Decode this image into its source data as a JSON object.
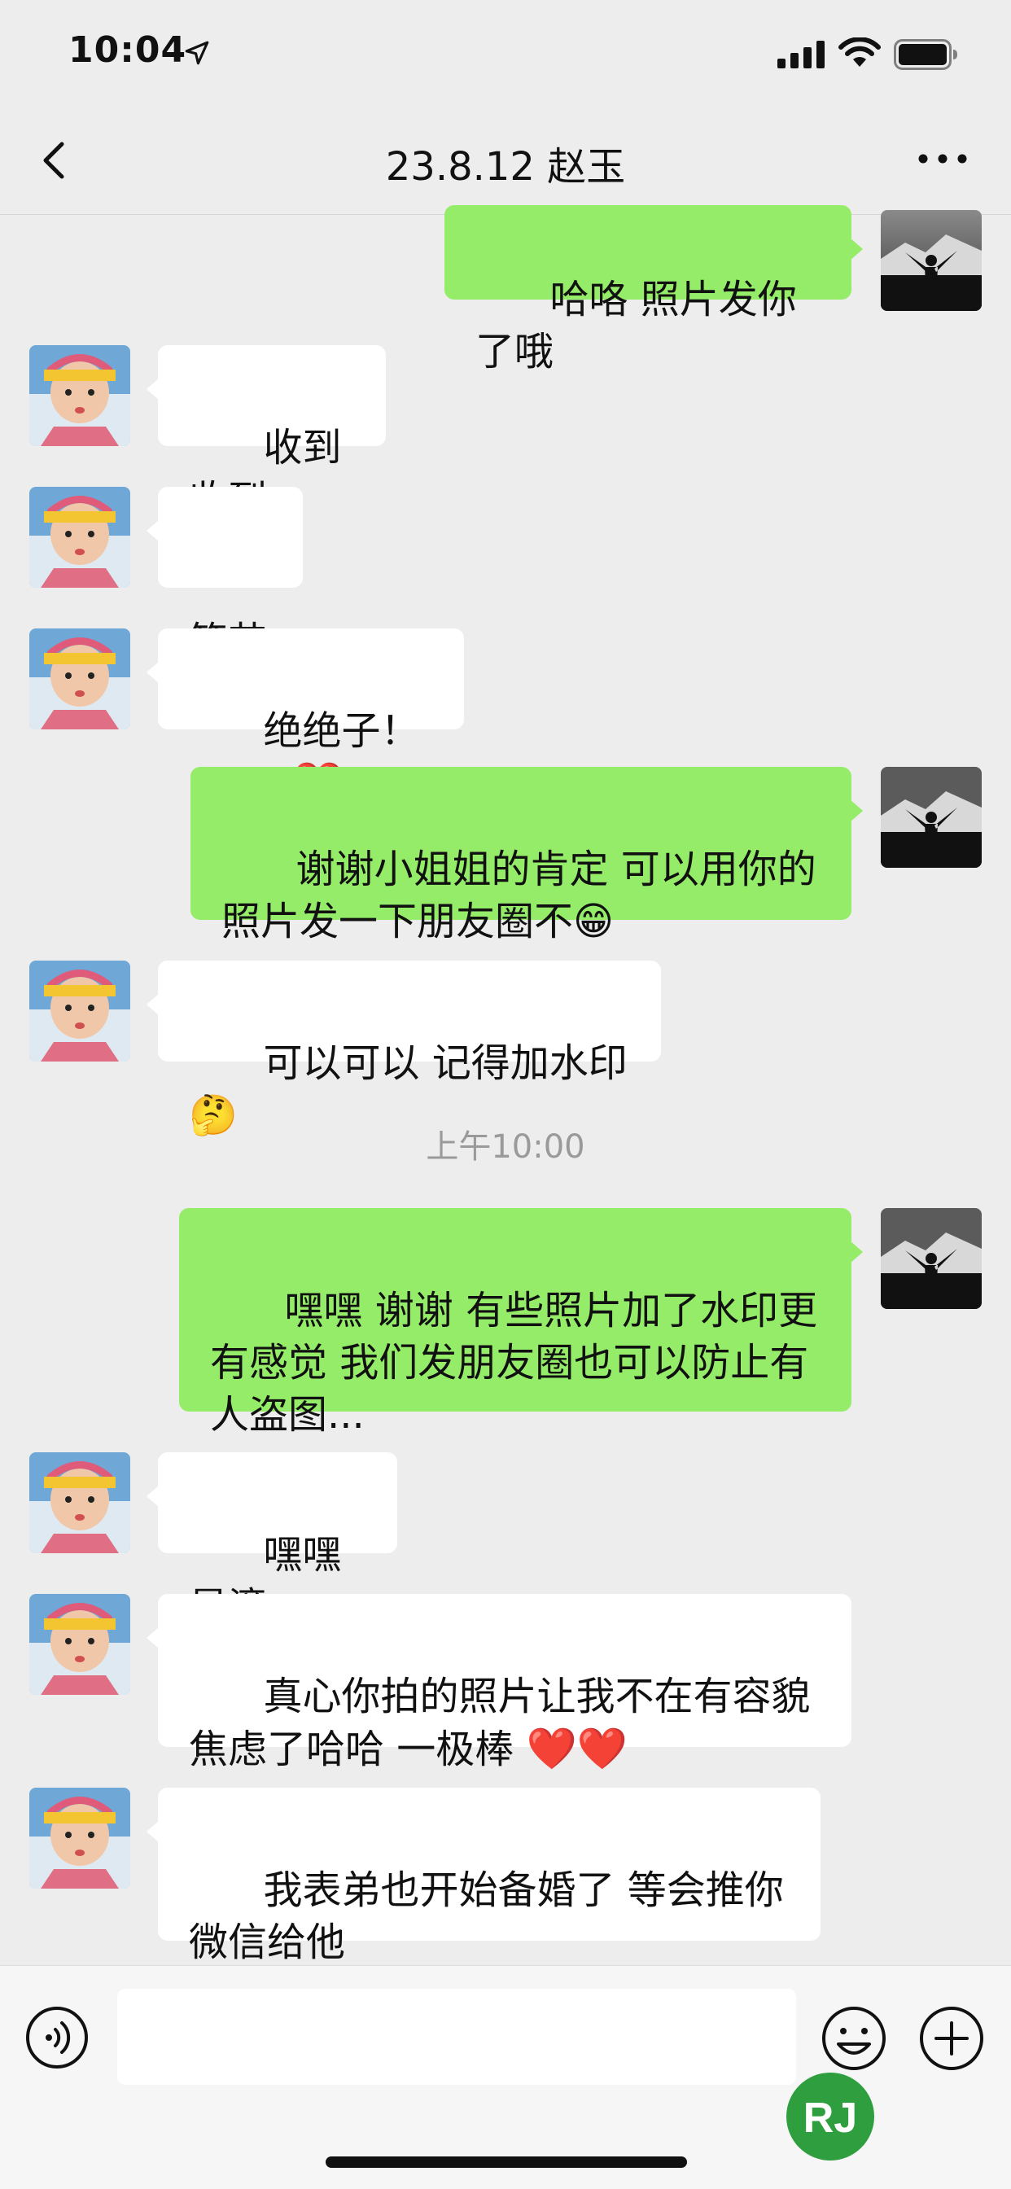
{
  "status_bar": {
    "time": "10:04"
  },
  "nav": {
    "title": "23.8.12 赵玉"
  },
  "chat": {
    "messages": [
      {
        "side": "out",
        "text": "哈咯 照片发你了哦"
      },
      {
        "side": "in",
        "text": "收到收到"
      },
      {
        "side": "in",
        "text": "笔芯"
      },
      {
        "side": "in",
        "text": "绝绝子！",
        "emoji": "❤️"
      },
      {
        "side": "out",
        "text": "谢谢小姐姐的肯定 可以用你的照片发一下朋友圈不😁"
      },
      {
        "side": "in",
        "text": "可以可以 记得加水印🤔"
      },
      {
        "side": "out",
        "text": "嘿嘿 谢谢 有些照片加了水印更有感觉 我们发朋友圈也可以防止有人盗图..."
      },
      {
        "side": "in",
        "text": "嘿嘿 是滴"
      },
      {
        "side": "in",
        "text": "真心你拍的照片让我不在有容貌焦虑了哈哈 一极棒 ",
        "emoji": "❤️❤️"
      },
      {
        "side": "in",
        "text": "我表弟也开始备婚了 等会推你微信给他"
      }
    ],
    "timestamp": "上午10:00"
  },
  "input_bar": {
    "placeholder": "",
    "icons": [
      "voice-icon",
      "emoji-icon",
      "plus-icon"
    ]
  },
  "watermark": {
    "text": "RJ",
    "color": "#2e9e3f"
  },
  "colors": {
    "out_bubble": "#95ec69",
    "in_bubble": "#ffffff",
    "background": "#ededed"
  }
}
